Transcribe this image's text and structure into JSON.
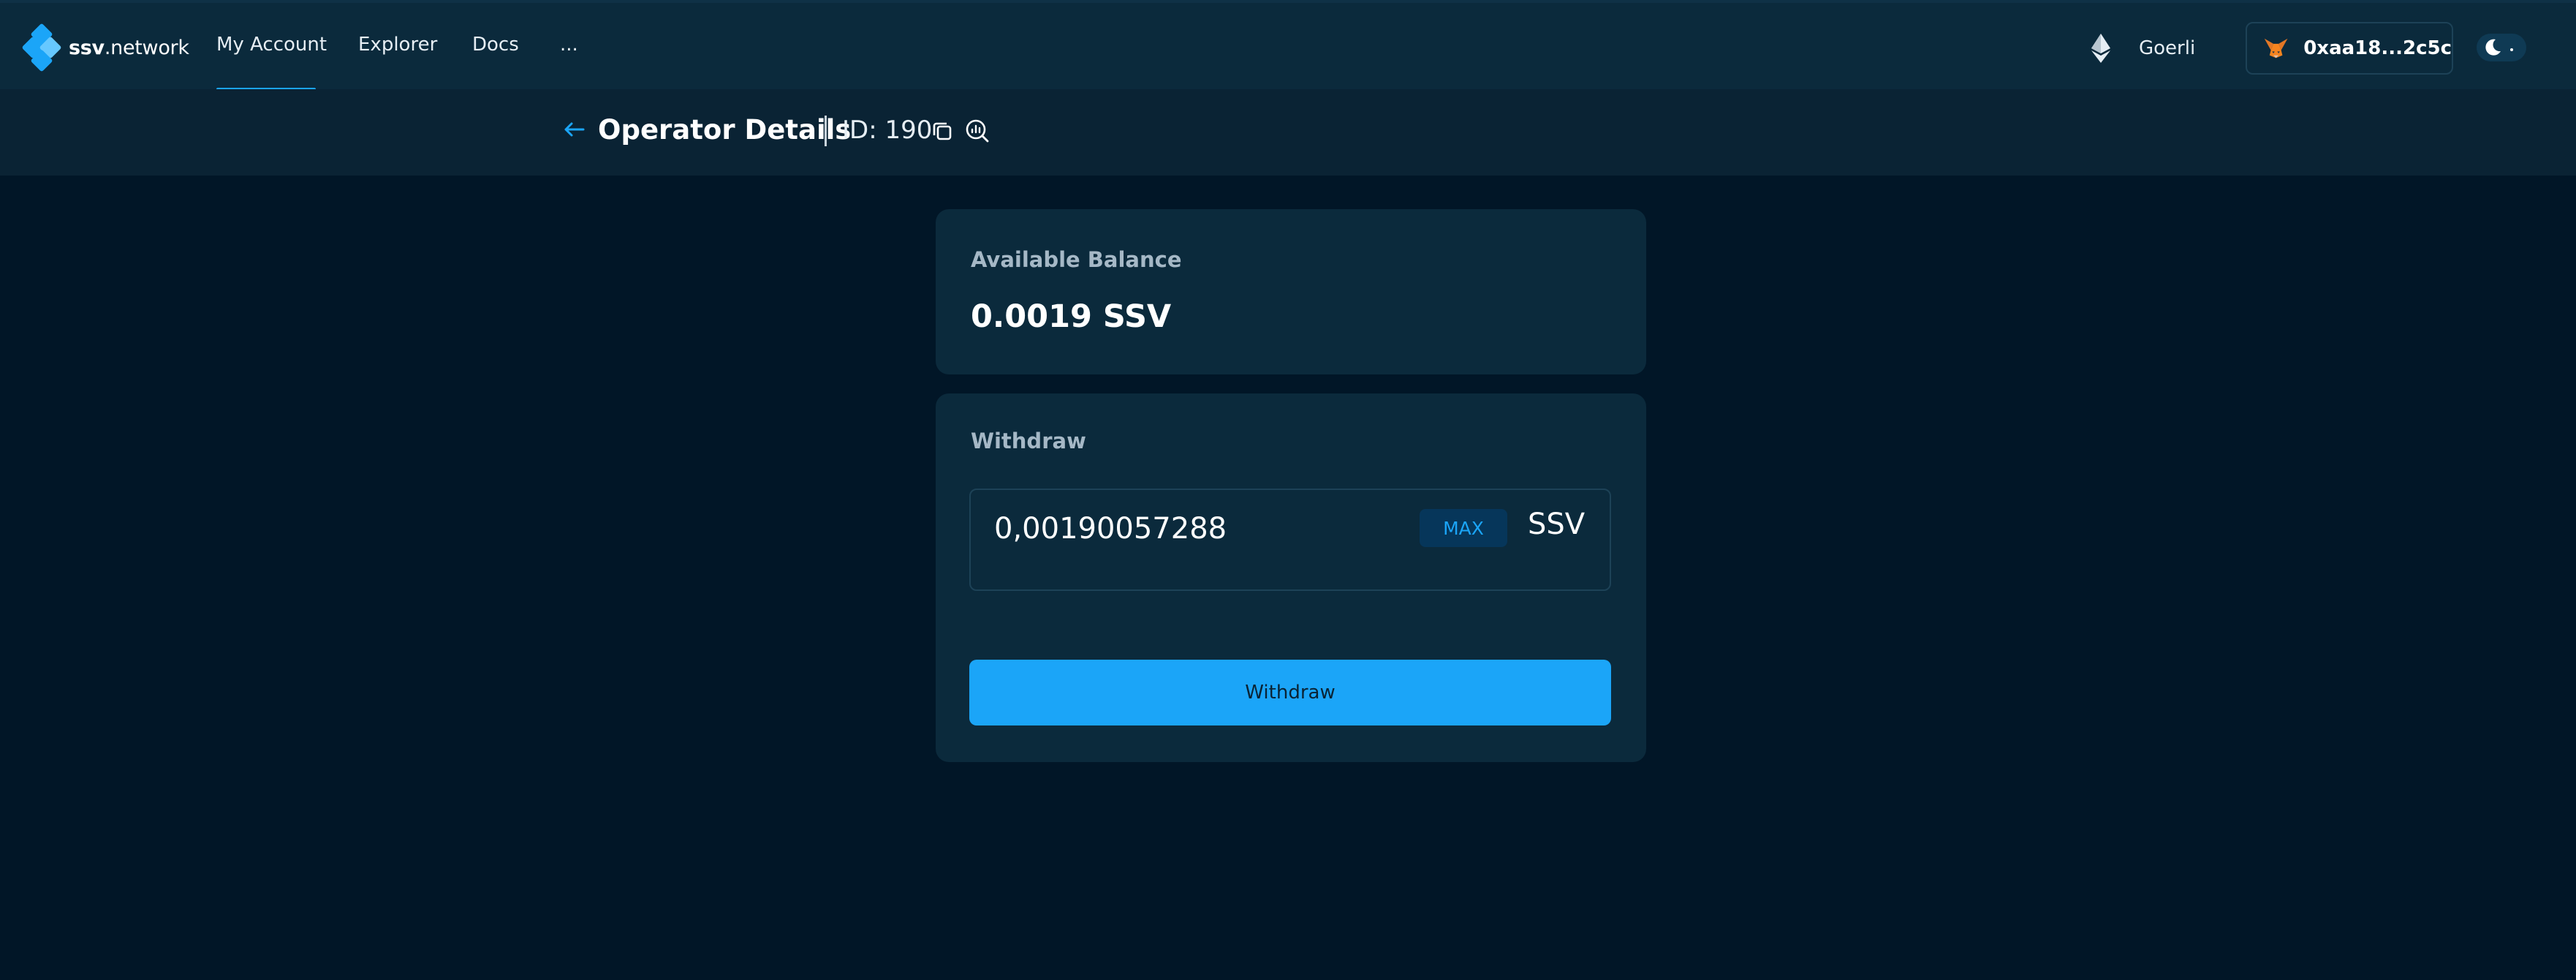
{
  "header": {
    "logo": {
      "bold": "ssv",
      "rest": ".network"
    },
    "nav": [
      "My Account",
      "Explorer",
      "Docs",
      "..."
    ],
    "network": "Goerli",
    "wallet": "0xaa18...2c5c"
  },
  "subheader": {
    "back_icon": "arrow-left-icon",
    "title": "Operator Details",
    "operator_id": "ID: 190",
    "copy_icon": "copy-icon",
    "explorer_icon": "explorer-icon"
  },
  "balance": {
    "label": "Available Balance",
    "value": "0.0019 SSV"
  },
  "withdraw": {
    "label": "Withdraw",
    "amount": "0,00190057288",
    "max_label": "MAX",
    "token": "SSV",
    "button_label": "Withdraw"
  },
  "colors": {
    "background": "#011627",
    "card": "#0b2a3c",
    "accent": "#1ba5f8"
  }
}
